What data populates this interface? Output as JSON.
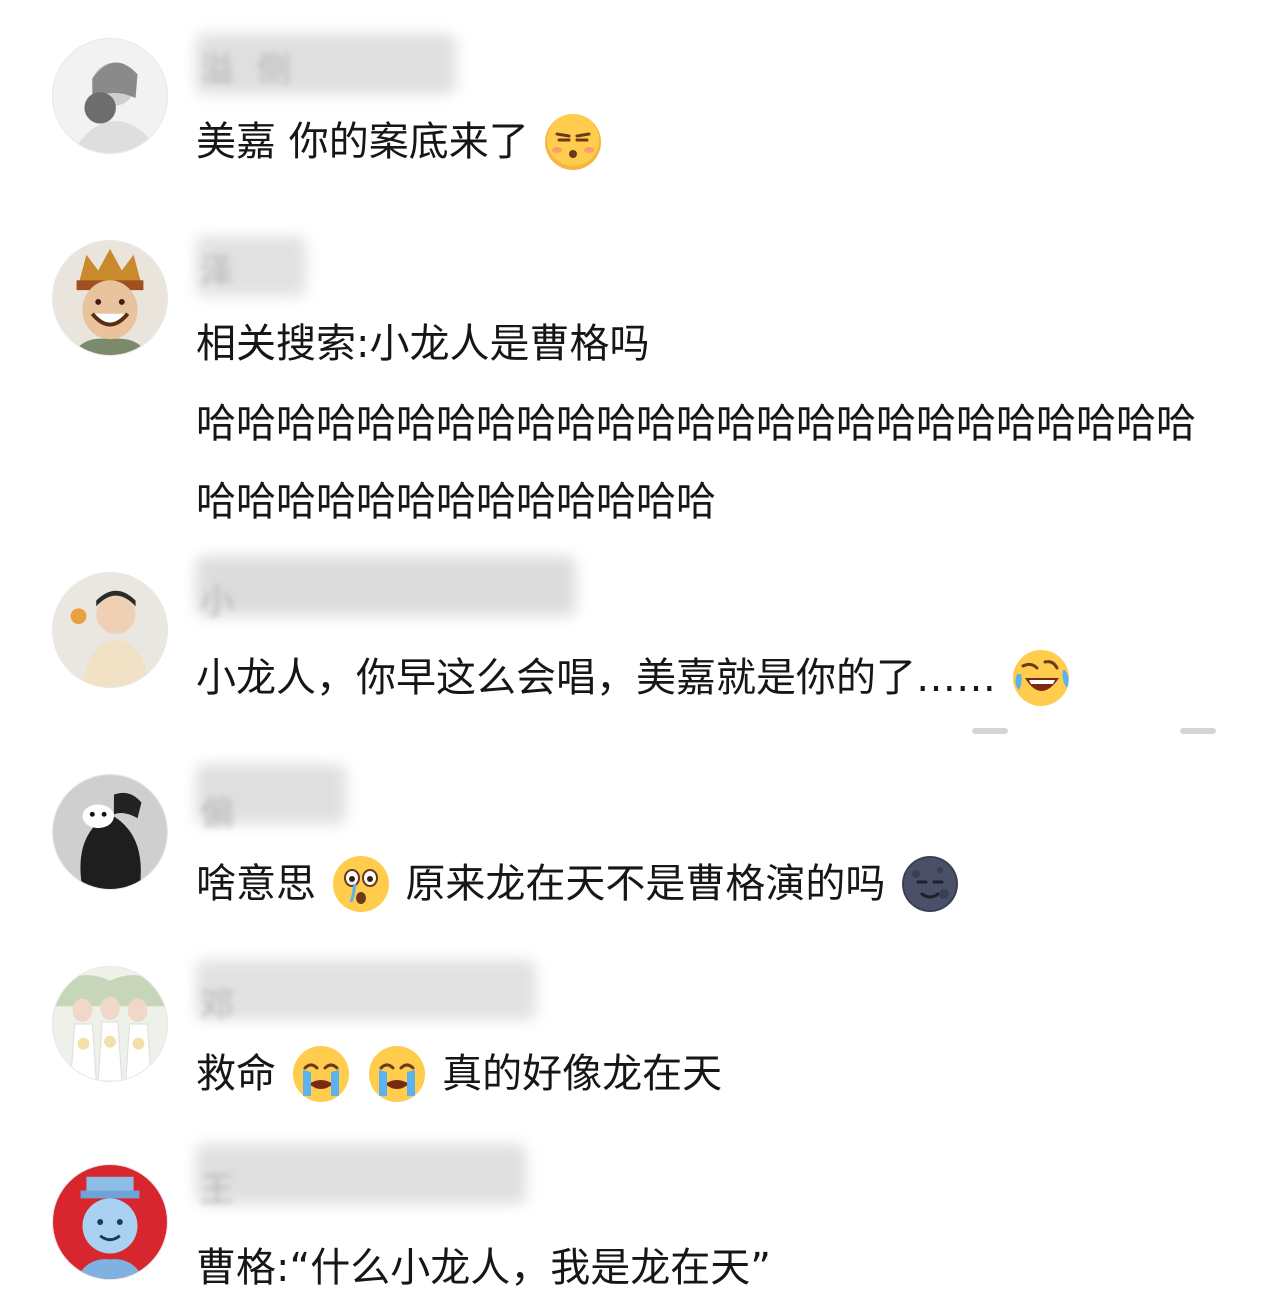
{
  "comments": [
    {
      "username": "溢 侧",
      "text_parts": [
        "美嘉 你的案底来了"
      ],
      "emojis": [
        "smirk-face-icon"
      ]
    },
    {
      "username": "泽",
      "lines": [
        "相关搜索:小龙人是曹格吗",
        "哈哈哈哈哈哈哈哈哈哈哈哈哈哈哈哈哈哈哈哈哈哈哈哈哈",
        "哈哈哈哈哈哈哈哈哈哈哈哈哈"
      ]
    },
    {
      "username": "小",
      "text_parts": [
        "小龙人，你早这么会唱，美嘉就是你的了……"
      ],
      "emojis": [
        "rolling-laugh-icon"
      ]
    },
    {
      "username": "偏",
      "text_parts": [
        "啥意思",
        "原来龙在天不是曹格演的吗"
      ],
      "emojis": [
        "surprised-face-icon",
        "dark-moon-face-icon"
      ]
    },
    {
      "username": "邓",
      "text_parts": [
        "救命",
        "真的好像龙在天"
      ],
      "emojis": [
        "crying-face-icon",
        "crying-face-icon"
      ]
    },
    {
      "username": "王",
      "text_parts": [
        "曹格:“什么小龙人，我是龙在天”"
      ]
    }
  ]
}
